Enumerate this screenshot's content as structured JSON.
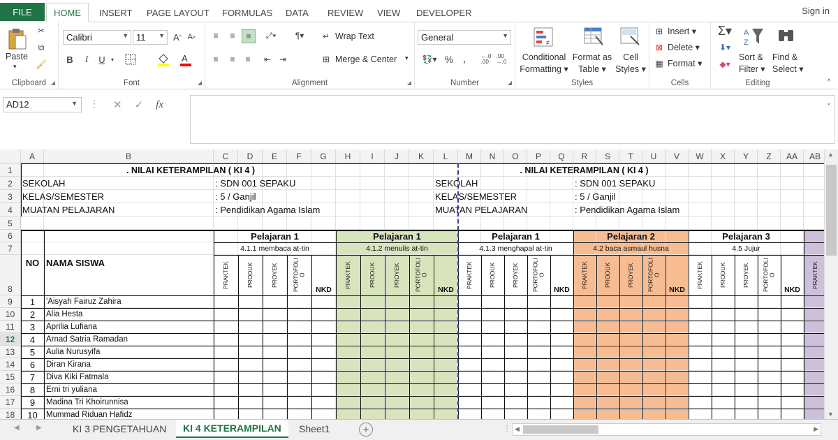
{
  "ribbon_tabs": {
    "file": "FILE",
    "home": "HOME",
    "insert": "INSERT",
    "page_layout": "PAGE LAYOUT",
    "formulas": "FORMULAS",
    "data": "DATA",
    "review": "REVIEW",
    "view": "VIEW",
    "developer": "DEVELOPER"
  },
  "signin": "Sign in",
  "clipboard": {
    "paste": "Paste",
    "label": "Clipboard"
  },
  "font": {
    "name": "Calibri",
    "size": "11",
    "label": "Font",
    "bold": "B",
    "italic": "I",
    "underline": "U"
  },
  "alignment": {
    "wrap": "Wrap Text",
    "merge": "Merge & Center",
    "label": "Alignment"
  },
  "number": {
    "format": "General",
    "percent": "%",
    "comma": ",",
    "label": "Number"
  },
  "styles": {
    "cond1": "Conditional",
    "cond2": "Formatting",
    "fat1": "Format as",
    "fat2": "Table",
    "cs1": "Cell",
    "cs2": "Styles",
    "label": "Styles"
  },
  "cells": {
    "insert": "Insert",
    "delete": "Delete",
    "format": "Format",
    "label": "Cells"
  },
  "editing": {
    "sort1": "Sort &",
    "sort2": "Filter",
    "find1": "Find &",
    "find2": "Select",
    "label": "Editing"
  },
  "formula_bar": {
    "name_box": "AD12",
    "fx": "fx",
    "cancel": "✕",
    "enter": "✓",
    "value": ""
  },
  "columns": [
    "A",
    "B",
    "C",
    "D",
    "E",
    "F",
    "G",
    "H",
    "I",
    "J",
    "K",
    "L",
    "M",
    "N",
    "O",
    "P",
    "Q",
    "R",
    "S",
    "T",
    "U",
    "V",
    "W",
    "X",
    "Y",
    "Z",
    "AA",
    "AB"
  ],
  "rows": [
    "1",
    "2",
    "3",
    "4",
    "5",
    "6",
    "7",
    "8",
    "9",
    "10",
    "11",
    "12",
    "13",
    "14",
    "15",
    "16",
    "17",
    "18"
  ],
  "header_left": {
    "title": ". NILAI KETERAMPILAN ( KI 4 )",
    "sekolah_l": "SEKOLAH",
    "sekolah_v": ": SDN 001 SEPAKU",
    "kelas_l": "KELAS/SEMESTER",
    "kelas_v": ": 5 / Ganjil",
    "muatan_l": "MUATAN PELAJARAN",
    "muatan_v": ": Pendidikan Agama Islam"
  },
  "header_right": {
    "title": ". NILAI KETERAMPILAN ( KI 4 )",
    "sekolah_l": "SEKOLAH",
    "sekolah_v": ": SDN 001 SEPAKU",
    "kelas_l": "KELAS/SEMESTER",
    "kelas_v": ": 5 / Ganjil",
    "muatan_l": "MUATAN PELAJARAN",
    "muatan_v": ": Pendidikan Agama Islam"
  },
  "table_head": {
    "no": "NO",
    "nama": "NAMA SISWA"
  },
  "lessons": [
    {
      "title": "Pelajaran 1",
      "kd": "4.1.1 membaca at-tin",
      "color": "#ffffff"
    },
    {
      "title": "Pelajaran 1",
      "kd": "4.1.2 menulis at-tin",
      "color": "#d8e4bc"
    },
    {
      "title": "Pelajaran 1",
      "kd": "4.1.3 menghapal at-tin",
      "color": "#ffffff"
    },
    {
      "title": "Pelajaran 2",
      "kd": "4.2 baca asmaul husna",
      "color": "#f8bc92"
    },
    {
      "title": "Pelajaran 3",
      "kd": "4.5  Jujur",
      "color": "#ffffff"
    }
  ],
  "sub_cols": {
    "praktek": "PRAKTEK",
    "produk": "PRODUK",
    "proyek": "PROYEK",
    "portofolio": "PORTOFOLI O",
    "nkd": "NKD"
  },
  "last_col": {
    "praktek": "PRAKTEK",
    "color": "#ccc0da"
  },
  "students": [
    {
      "no": "1",
      "name": "'Aisyah Fairuz Zahira"
    },
    {
      "no": "2",
      "name": "Alia Hesta"
    },
    {
      "no": "3",
      "name": "Aprilia Lufiana"
    },
    {
      "no": "4",
      "name": "Arnad Satria Ramadan"
    },
    {
      "no": "5",
      "name": "Aulia Nurusyifa"
    },
    {
      "no": "6",
      "name": "Diran Kirana"
    },
    {
      "no": "7",
      "name": "Diva Kiki Fatmala"
    },
    {
      "no": "8",
      "name": "Erni tri yuliana"
    },
    {
      "no": "9",
      "name": "Madina Tri Khoirunnisa"
    },
    {
      "no": "10",
      "name": "Mummad Riduan Hafidz"
    }
  ],
  "selected_row": "12",
  "sheets": [
    "KI 3 PENGETAHUAN",
    "KI 4 KETERAMPILAN",
    "Sheet1"
  ],
  "active_sheet": "KI 4 KETERAMPILAN",
  "colors": {
    "accent": "#217346"
  }
}
